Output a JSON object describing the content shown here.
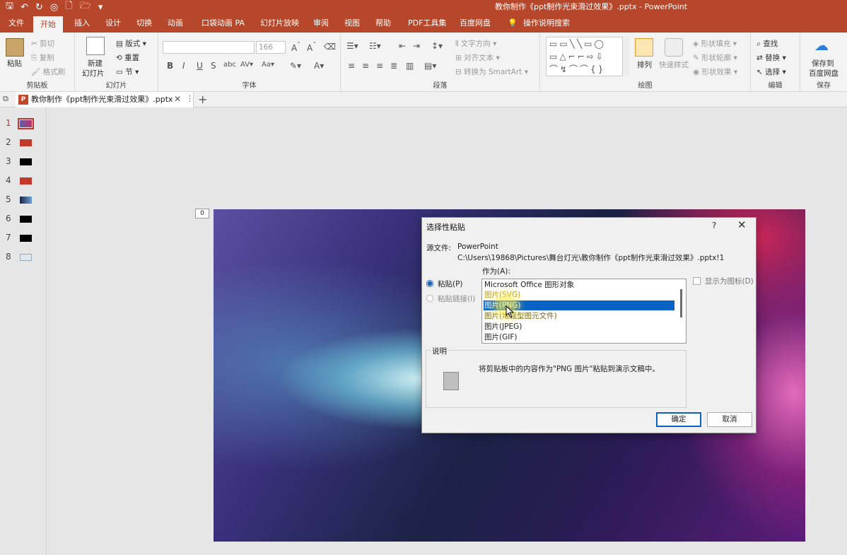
{
  "window": {
    "title": "教你制作《ppt制作光束滑过效果》.pptx  -  PowerPoint"
  },
  "ribbon_tabs": [
    "文件",
    "开始",
    "插入",
    "设计",
    "切换",
    "动画",
    "口袋动画 PA",
    "幻灯片放映",
    "审阅",
    "视图",
    "帮助",
    "PDF工具集",
    "百度网盘",
    "操作说明搜索"
  ],
  "ribbon": {
    "clipboard": {
      "paste": "粘贴",
      "cut": "剪切",
      "copy": "复制",
      "format_painter": "格式刷",
      "label": "剪贴板"
    },
    "slides": {
      "new_slide_line1": "新建",
      "new_slide_line2": "幻灯片",
      "layout": "版式",
      "reset": "重置",
      "section": "节",
      "label": "幻灯片"
    },
    "font": {
      "size": "166",
      "label": "字体"
    },
    "paragraph": {
      "text_direction": "文字方向",
      "align_text": "对齐文本",
      "smartart": "转换为 SmartArt",
      "label": "段落"
    },
    "drawing": {
      "arrange": "排列",
      "quick_styles": "快速样式",
      "shape_fill": "形状填充",
      "shape_outline": "形状轮廓",
      "shape_effects": "形状效果",
      "label": "绘图"
    },
    "editing": {
      "find": "查找",
      "replace": "替换",
      "select": "选择",
      "label": "编辑"
    },
    "save": {
      "line1": "保存到",
      "line2": "百度网盘",
      "label": "保存"
    }
  },
  "doc_tab": {
    "name": "教你制作《ppt制作光束滑过效果》.pptx"
  },
  "thumbnails": [
    "1",
    "2",
    "3",
    "4",
    "5",
    "6",
    "7",
    "8"
  ],
  "slide_marker": "0",
  "dialog": {
    "title": "选择性粘贴",
    "help": "?",
    "source_label": "源文件:",
    "source_app": "PowerPoint",
    "source_path": "C:\\Users\\19868\\Pictures\\舞台灯光\\教你制作《ppt制作光束滑过效果》.pptx!1",
    "as_label": "作为(A):",
    "paste_option": "粘贴(P)",
    "paste_link_option": "粘贴链接(I)",
    "list_items": [
      "Microsoft Office 图形对象",
      "图片(SVG)",
      "图片(PNG)",
      "图片(增强型图元文件)",
      "图片(JPEG)",
      "图片(GIF)"
    ],
    "selected_index": 2,
    "show_as_icon": "显示为图标(D)",
    "desc_title": "说明",
    "desc_text": "将剪贴板中的内容作为\"PNG 图片\"粘贴到演示文稿中。",
    "ok": "确定",
    "cancel": "取消"
  },
  "colors": {
    "accent": "#b7472a",
    "selection": "#0a62c4"
  }
}
